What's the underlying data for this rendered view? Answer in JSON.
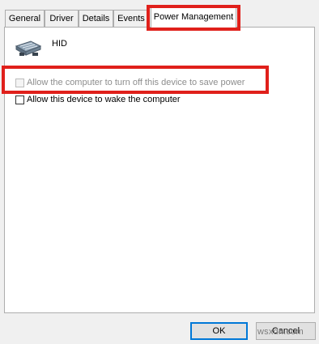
{
  "tabs": [
    {
      "label": "General",
      "active": false
    },
    {
      "label": "Driver",
      "active": false
    },
    {
      "label": "Details",
      "active": false
    },
    {
      "label": "Events",
      "active": false
    },
    {
      "label": "Power Management",
      "active": true
    }
  ],
  "device": {
    "icon": "keyboard-device-icon",
    "name": "HID"
  },
  "options": [
    {
      "label": "Allow the computer to turn off this device to save power",
      "checked": false,
      "enabled": false
    },
    {
      "label": "Allow this device to wake the computer",
      "checked": false,
      "enabled": true
    }
  ],
  "buttons": {
    "ok": "OK",
    "cancel": "Cancel"
  },
  "watermark": "wsxdn.com",
  "colors": {
    "highlight": "#e0201b",
    "default_button_border": "#0078d7"
  }
}
